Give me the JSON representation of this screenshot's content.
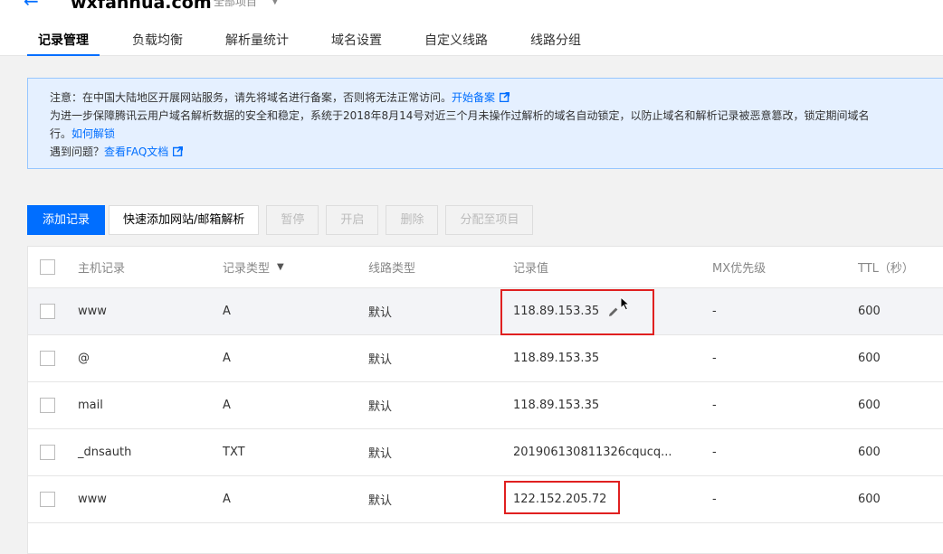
{
  "header": {
    "domain": "wxfanhua.com",
    "project": "全部项目",
    "caret": "▼",
    "back_icon": "←"
  },
  "tabs": [
    {
      "label": "记录管理",
      "active": true
    },
    {
      "label": "负载均衡"
    },
    {
      "label": "解析量统计"
    },
    {
      "label": "域名设置"
    },
    {
      "label": "自定义线路"
    },
    {
      "label": "线路分组"
    }
  ],
  "notice": {
    "line1_text": "注意：在中国大陆地区开展网站服务，请先将域名进行备案，否则将无法正常访问。",
    "line1_link": "开始备案",
    "line2_text": "为进一步保障腾讯云用户域名解析数据的安全和稳定，系统于2018年8月14号对近三个月未操作过解析的域名自动锁定，以防止域名和解析记录被恶意篡改，锁定期间域名",
    "line3_text": "行。",
    "line3_link": "如何解锁",
    "line4_text": "遇到问题？",
    "line4_link": "查看FAQ文档"
  },
  "toolbar": {
    "add": "添加记录",
    "quick_add": "快速添加网站/邮箱解析",
    "pause": "暂停",
    "enable": "开启",
    "delete": "删除",
    "assign": "分配至项目"
  },
  "table": {
    "headers": {
      "host": "主机记录",
      "type": "记录类型",
      "line": "线路类型",
      "value": "记录值",
      "mx": "MX优先级",
      "ttl": "TTL（秒）"
    },
    "filter_icon": "▼",
    "rows": [
      {
        "host": "www",
        "type": "A",
        "line": "默认",
        "value": "118.89.153.35",
        "mx": "-",
        "ttl": "600"
      },
      {
        "host": "@",
        "type": "A",
        "line": "默认",
        "value": "118.89.153.35",
        "mx": "-",
        "ttl": "600"
      },
      {
        "host": "mail",
        "type": "A",
        "line": "默认",
        "value": "118.89.153.35",
        "mx": "-",
        "ttl": "600"
      },
      {
        "host": "_dnsauth",
        "type": "TXT",
        "line": "默认",
        "value": "201906130811326cqucq...",
        "mx": "-",
        "ttl": "600"
      },
      {
        "host": "www",
        "type": "A",
        "line": "默认",
        "value": "122.152.205.72",
        "mx": "-",
        "ttl": "600"
      }
    ]
  },
  "colors": {
    "accent": "#006eff",
    "highlight": "#e02020",
    "notice_bg": "#e5f0ff"
  }
}
